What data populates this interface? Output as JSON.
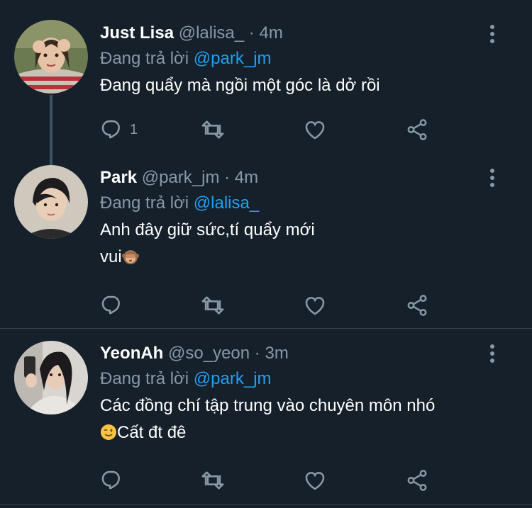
{
  "tweets": [
    {
      "display_name": "Just Lisa",
      "handle": "@lalisa_",
      "separator": "·",
      "time": "4m",
      "reply_prefix": "Đang trả lời",
      "reply_to": "@park_jm",
      "text_lines": [
        "Đang quẩy mà ngồi một góc là dở rồi"
      ],
      "reply_count": "1",
      "emoji": ""
    },
    {
      "display_name": "Park",
      "handle": "@park_jm",
      "separator": "·",
      "time": "4m",
      "reply_prefix": "Đang trả lời",
      "reply_to": "@lalisa_",
      "text_lines": [
        "Anh đây giữ sức,tí quẩy mới",
        "vui"
      ],
      "reply_count": "",
      "emoji": "see-no-evil-monkey"
    },
    {
      "display_name": "YeonAh",
      "handle": "@so_yeon",
      "separator": "·",
      "time": "3m",
      "reply_prefix": "Đang trả lời",
      "reply_to": "@park_jm",
      "text_lines": [
        "Các đồng chí tập trung vào chuyên môn nhó",
        "Cất đt đê"
      ],
      "reply_count": "",
      "emoji": "winking-face"
    }
  ],
  "icons": {
    "reply": "reply-icon",
    "retweet": "retweet-icon",
    "like": "heart-icon",
    "share": "share-icon",
    "more": "more-vertical-icon"
  },
  "colors": {
    "background": "#15202b",
    "secondary_text": "#8899a6",
    "mention": "#1da1f2",
    "divider": "#38444d",
    "thread_line": "#3d5466"
  }
}
